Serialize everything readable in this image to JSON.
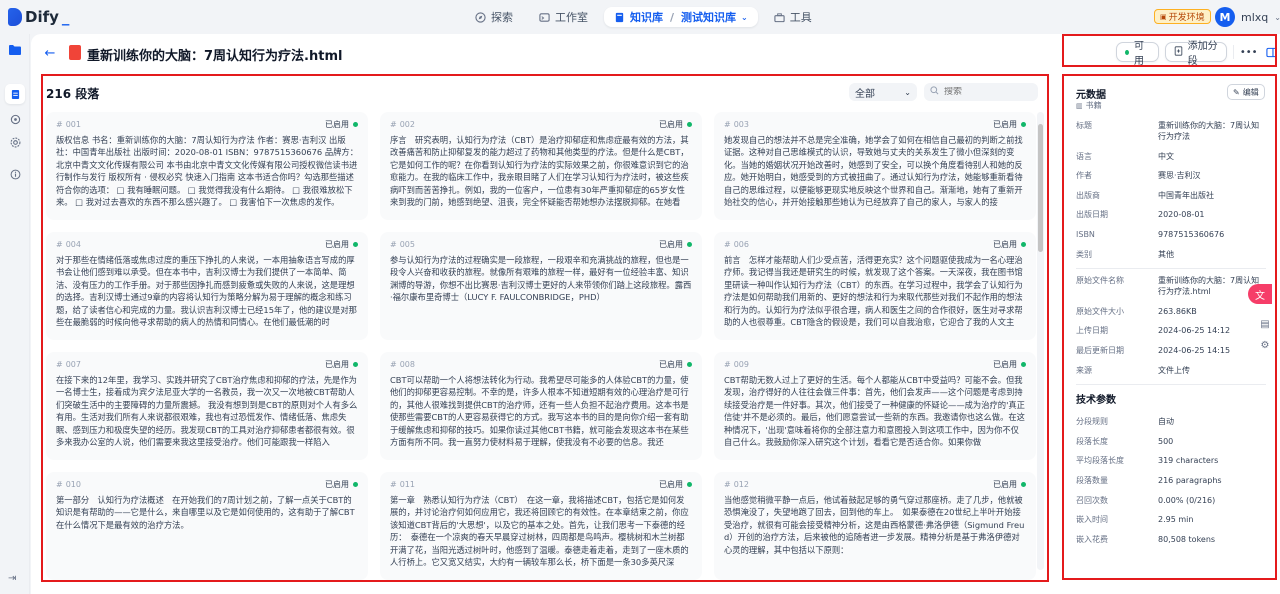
{
  "app": {
    "name": "Dify",
    "env_badge": "开发环境"
  },
  "nav": {
    "explore": "探索",
    "studio": "工作室",
    "knowledge": "知识库",
    "current_kb": "测试知识库",
    "tools": "工具"
  },
  "user": {
    "initial": "M",
    "name": "mlxq"
  },
  "document": {
    "title": "重新训练你的大脑：7周认知行为疗法.html"
  },
  "header_actions": {
    "status_label": "可用",
    "add_segment": "添加分段"
  },
  "segments_panel": {
    "count_label": "216 段落",
    "filter_value": "全部",
    "search_placeholder": "搜索"
  },
  "segments": [
    {
      "num": "001",
      "status": "已启用",
      "text": "版权信息 书名：重新训练你的大脑：7周认知行为疗法 作者：赛思·吉利汉 出版社：中国青年出版社 出版时间：2020-08-01 ISBN：9787515360676 品牌方：北京中青文文化传媒有限公司 本书由北京中青文文化传媒有限公司授权微信读书进行制作与发行 版权所有 · 侵权必究 快速入门指南 这本书适合你吗？勾选那些描述符合你的选项： □ 我有睡眠问题。 □ 我觉得我没有什么期待。 □ 我很难放松下来。 □ 我对过去喜欢的东西不那么感兴趣了。 □ 我害怕下一次焦虑的发作。"
    },
    {
      "num": "002",
      "status": "已启用",
      "text": "序言　研究表明，认知行为疗法（CBT）是治疗抑郁症和焦虑症最有效的方法，其改善痛苦和防止抑郁复发的能力超过了药物和其他类型的疗法。但是什么是CBT，它是如何工作的呢？在你看到认知行为疗法的实际效果之前，你很难意识到它的治愈能力。在我的临床工作中，我亲眼目睹了人们在学习认知行为疗法时，被这些疾病吓到而苦苦挣扎。例如，我的一位客户，一位患有30年严重抑郁症的65岁女性来到我的门前，她感到绝望、沮丧，完全怀疑能否帮她想办法摆脱抑郁。在她看"
    },
    {
      "num": "003",
      "status": "已启用",
      "text": "她发现自己的想法并不总是完全准确，她学会了如何在相信自己最初的判断之前找证据。这种对自己思维模式的认识，导致她与丈夫的关系发生了微小但深刻的变化。当她的婚姻状况开始改善时，她感到了安全，可以换个角度看待别人和她的反应。她开始明白，她感受到的方式被扭曲了。通过认知行为疗法，她能够重新看待自己的思维过程，以便能够更现实地反映这个世界和自己。渐渐地，她有了重新开始社交的信心，并开始接触那些她认为已经放弃了自己的家人，与家人的接"
    },
    {
      "num": "004",
      "status": "已启用",
      "text": "对于那些在情绪低落或焦虑过度的重压下挣扎的人来说，一本用抽象语言写成的厚书会让他们感到难以承受。但在本书中，吉利汉博士为我们提供了一本简单、简洁、没有压力的工作手册。对于那些因挣扎而感到疲惫或失败的人来说，这是理想的选择。吉利汉博士通过9章的内容将认知行为策略分解为易于理解的概念和练习题，给了读者信心和完成的力量。我认识吉利汉博士已经15年了，他的建议是对那些在最脆弱的时候向他寻求帮助的病人的热情和同情心。在他们最低潮的时"
    },
    {
      "num": "005",
      "status": "已启用",
      "text": "参与认知行为疗法的过程确实是一段旅程，一段艰辛和充满挑战的旅程，但也是一段令人兴奋和收获的旅程。就像所有艰难的旅程一样，最好有一位经验丰富、知识渊博的导游，你想不出比赛思·吉利汉博士更好的人来带领你们踏上这段旅程。露西·福尔康布里奇博士（LUCY F. FAULCONBRIDGE，PHD）"
    },
    {
      "num": "006",
      "status": "已启用",
      "text": "前言　怎样才能帮助人们少受点苦，活得更充实？这个问题驱使我成为一名心理治疗师。我记得当我还是研究生的时候，就发现了这个答案。一天深夜，我在图书馆里研读一种叫作认知行为疗法（CBT）的东西。在学习过程中，我学会了认知行为疗法是如何帮助我们用新的、更好的想法和行为来取代那些对我们不起作用的想法和行为的。认知行为疗法似乎很合理，病人和医生之间的合作很好，医生对寻求帮助的人也很尊重。CBT隐含的假设是，我们可以自我治愈，它迎合了我的人文主"
    },
    {
      "num": "007",
      "status": "已启用",
      "text": "在接下来的12年里，我学习、实践并研究了CBT治疗焦虑和抑郁的疗法，先是作为一名博士生，接着成为宾夕法尼亚大学的一名教员，我一次又一次地被CBT帮助人们突破生活中的主要障碍的力量所震撼。 我没有想到到是CBT的原则对个人有多么有用。生活对我们所有人来说都很艰难，我也有过恐慌发作、情绪低落、焦虑失眠、感到压力和极度失望的经历。我发现CBT的工具对治疗抑郁患者都很有效。很多来我办公室的人说，他们需要来我这里接受治疗。他们可能跟我一样陷入"
    },
    {
      "num": "008",
      "status": "已启用",
      "text": "CBT可以帮助一个人将想法转化为行动。我希望尽可能多的人体验CBT的力量，使他们的抑郁更容易控制。不幸的是，许多人根本不知道短期有效的心理治疗是可行的，其他人很难找到提供CBT的治疗师，还有一些人负担不起治疗费用。这本书是使那些需要CBT的人更容易获得它的方式。我写这本书的目的是向你介绍一套有助于缓解焦虑和抑郁的技巧。如果你读过其他CBT书籍，就可能会发现这本书在某些方面有所不同。我一直努力使材料易于理解，使我没有不必要的信息。我还"
    },
    {
      "num": "009",
      "status": "已启用",
      "text": "CBT帮助无数人过上了更好的生活。每个人都能从CBT中受益吗？可能不会。但我发现，治疗得好的人往往会做三件事：首先，他们会发声——这个问题是考虑到持续接受治疗是一件好事。其次，他们接受了一种健康的怀疑论——成为治疗的'真正信徒'并不是必须的。最后，他们愿意尝试一些新的东西。我邀请你也这么做。在这种情况下，'出现'意味着将你的全部注意力和意图投入到这项工作中，因为你不仅自己什么。我鼓励你深入研究这个计划，看看它是否适合你。如果你做"
    },
    {
      "num": "010",
      "status": "已启用",
      "text": "第一部分　认知行为疗法概述　在开始我们的7周计划之前，了解一点关于CBT的知识是有帮助的——它是什么，来自哪里以及它是如何使用的，这有助于了解CBT在什么情况下是最有效的治疗方法。"
    },
    {
      "num": "011",
      "status": "已启用",
      "text": "第一章　熟悉认知行为疗法（CBT）　在这一章，我将描述CBT，包括它是如何发展的，并讨论治疗何如何应用它，我还将回顾它的有效性。在本章结束之前，你应该知道CBT背后的'大思想'，以及它的基本之处。首先，让我们思考一下泰德的经历：　泰德在一个凉爽的春天早晨穿过树林，四周都是鸟鸣声。樱桃树和木兰树都开满了花，当阳光透过树叶时，他感到了温暖。泰德走着走着，走到了一座木质的人行桥上。它又宽又结实，大约有一辆较车那么长，桥下面是一条30多英尺深"
    },
    {
      "num": "012",
      "status": "已启用",
      "text": "当他感觉稍微平静一点后，他试着鼓起足够的勇气穿过那座桥。走了几步，他就被恐惧淹没了，失望地跑了回去，回到他的车上。　如果泰德在20世纪上半叶开始接受治疗，就很有可能会接受精神分析，这是由西格蒙德·弗洛伊德（Sigmund Freud）开创的治疗方法，后来被他的追随者进一步发展。精神分析是基于弗洛伊德对心灵的理解，其中包括以下原则："
    }
  ],
  "metadata": {
    "title": "元数据",
    "type": "书籍",
    "edit": "编辑",
    "rows": [
      {
        "key": "标题",
        "value": "重新训练你的大脑：7周认知行为疗法"
      },
      {
        "key": "语言",
        "value": "中文"
      },
      {
        "key": "作者",
        "value": "赛思·吉利汉"
      },
      {
        "key": "出版商",
        "value": "中国青年出版社"
      },
      {
        "key": "出版日期",
        "value": "2020-08-01"
      },
      {
        "key": "ISBN",
        "value": "9787515360676"
      },
      {
        "key": "类别",
        "value": "其他"
      }
    ],
    "file_rows": [
      {
        "key": "原始文件名称",
        "value": "重新训练你的大脑：7周认知行为疗法.html"
      },
      {
        "key": "原始文件大小",
        "value": "263.86KB"
      },
      {
        "key": "上传日期",
        "value": "2024-06-25 14:12"
      },
      {
        "key": "最后更新日期",
        "value": "2024-06-25 14:15"
      },
      {
        "key": "来源",
        "value": "文件上传"
      }
    ],
    "tech_title": "技术参数",
    "tech_rows": [
      {
        "key": "分段规则",
        "value": "自动"
      },
      {
        "key": "段落长度",
        "value": "500"
      },
      {
        "key": "平均段落长度",
        "value": "319 characters"
      },
      {
        "key": "段落数量",
        "value": "216 paragraphs"
      },
      {
        "key": "召回次数",
        "value": "0.00% (0/216)"
      },
      {
        "key": "嵌入时间",
        "value": "2.95 min"
      },
      {
        "key": "嵌入花费",
        "value": "80,508 tokens"
      }
    ]
  },
  "colors": {
    "accent": "#155eef",
    "enabled_dot": "#12b76a",
    "annotation": "#e41a1c"
  }
}
